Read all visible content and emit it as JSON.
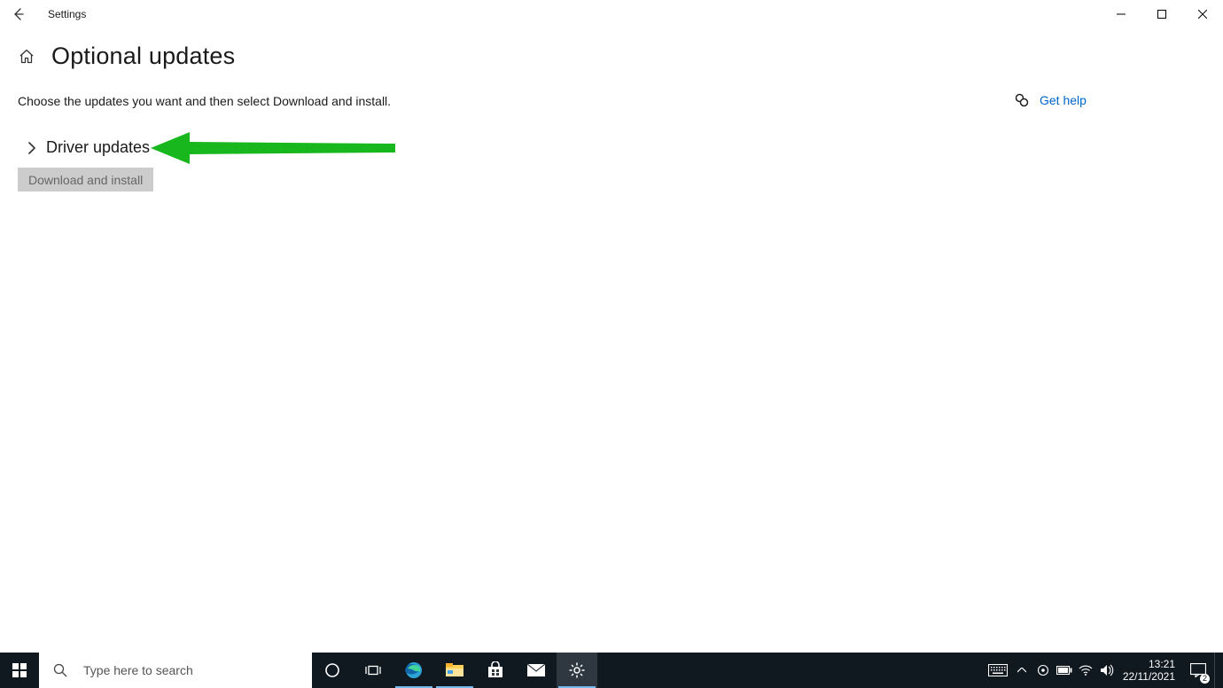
{
  "titlebar": {
    "app_name": "Settings"
  },
  "page": {
    "title": "Optional updates",
    "intro": "Choose the updates you want and then select Download and install."
  },
  "help": {
    "label": "Get help"
  },
  "section": {
    "driver_updates_label": "Driver updates",
    "download_button": "Download and install"
  },
  "taskbar": {
    "search_placeholder": "Type here to search"
  },
  "clock": {
    "time": "13:21",
    "date": "22/11/2021"
  },
  "action_center": {
    "badge": "2"
  }
}
